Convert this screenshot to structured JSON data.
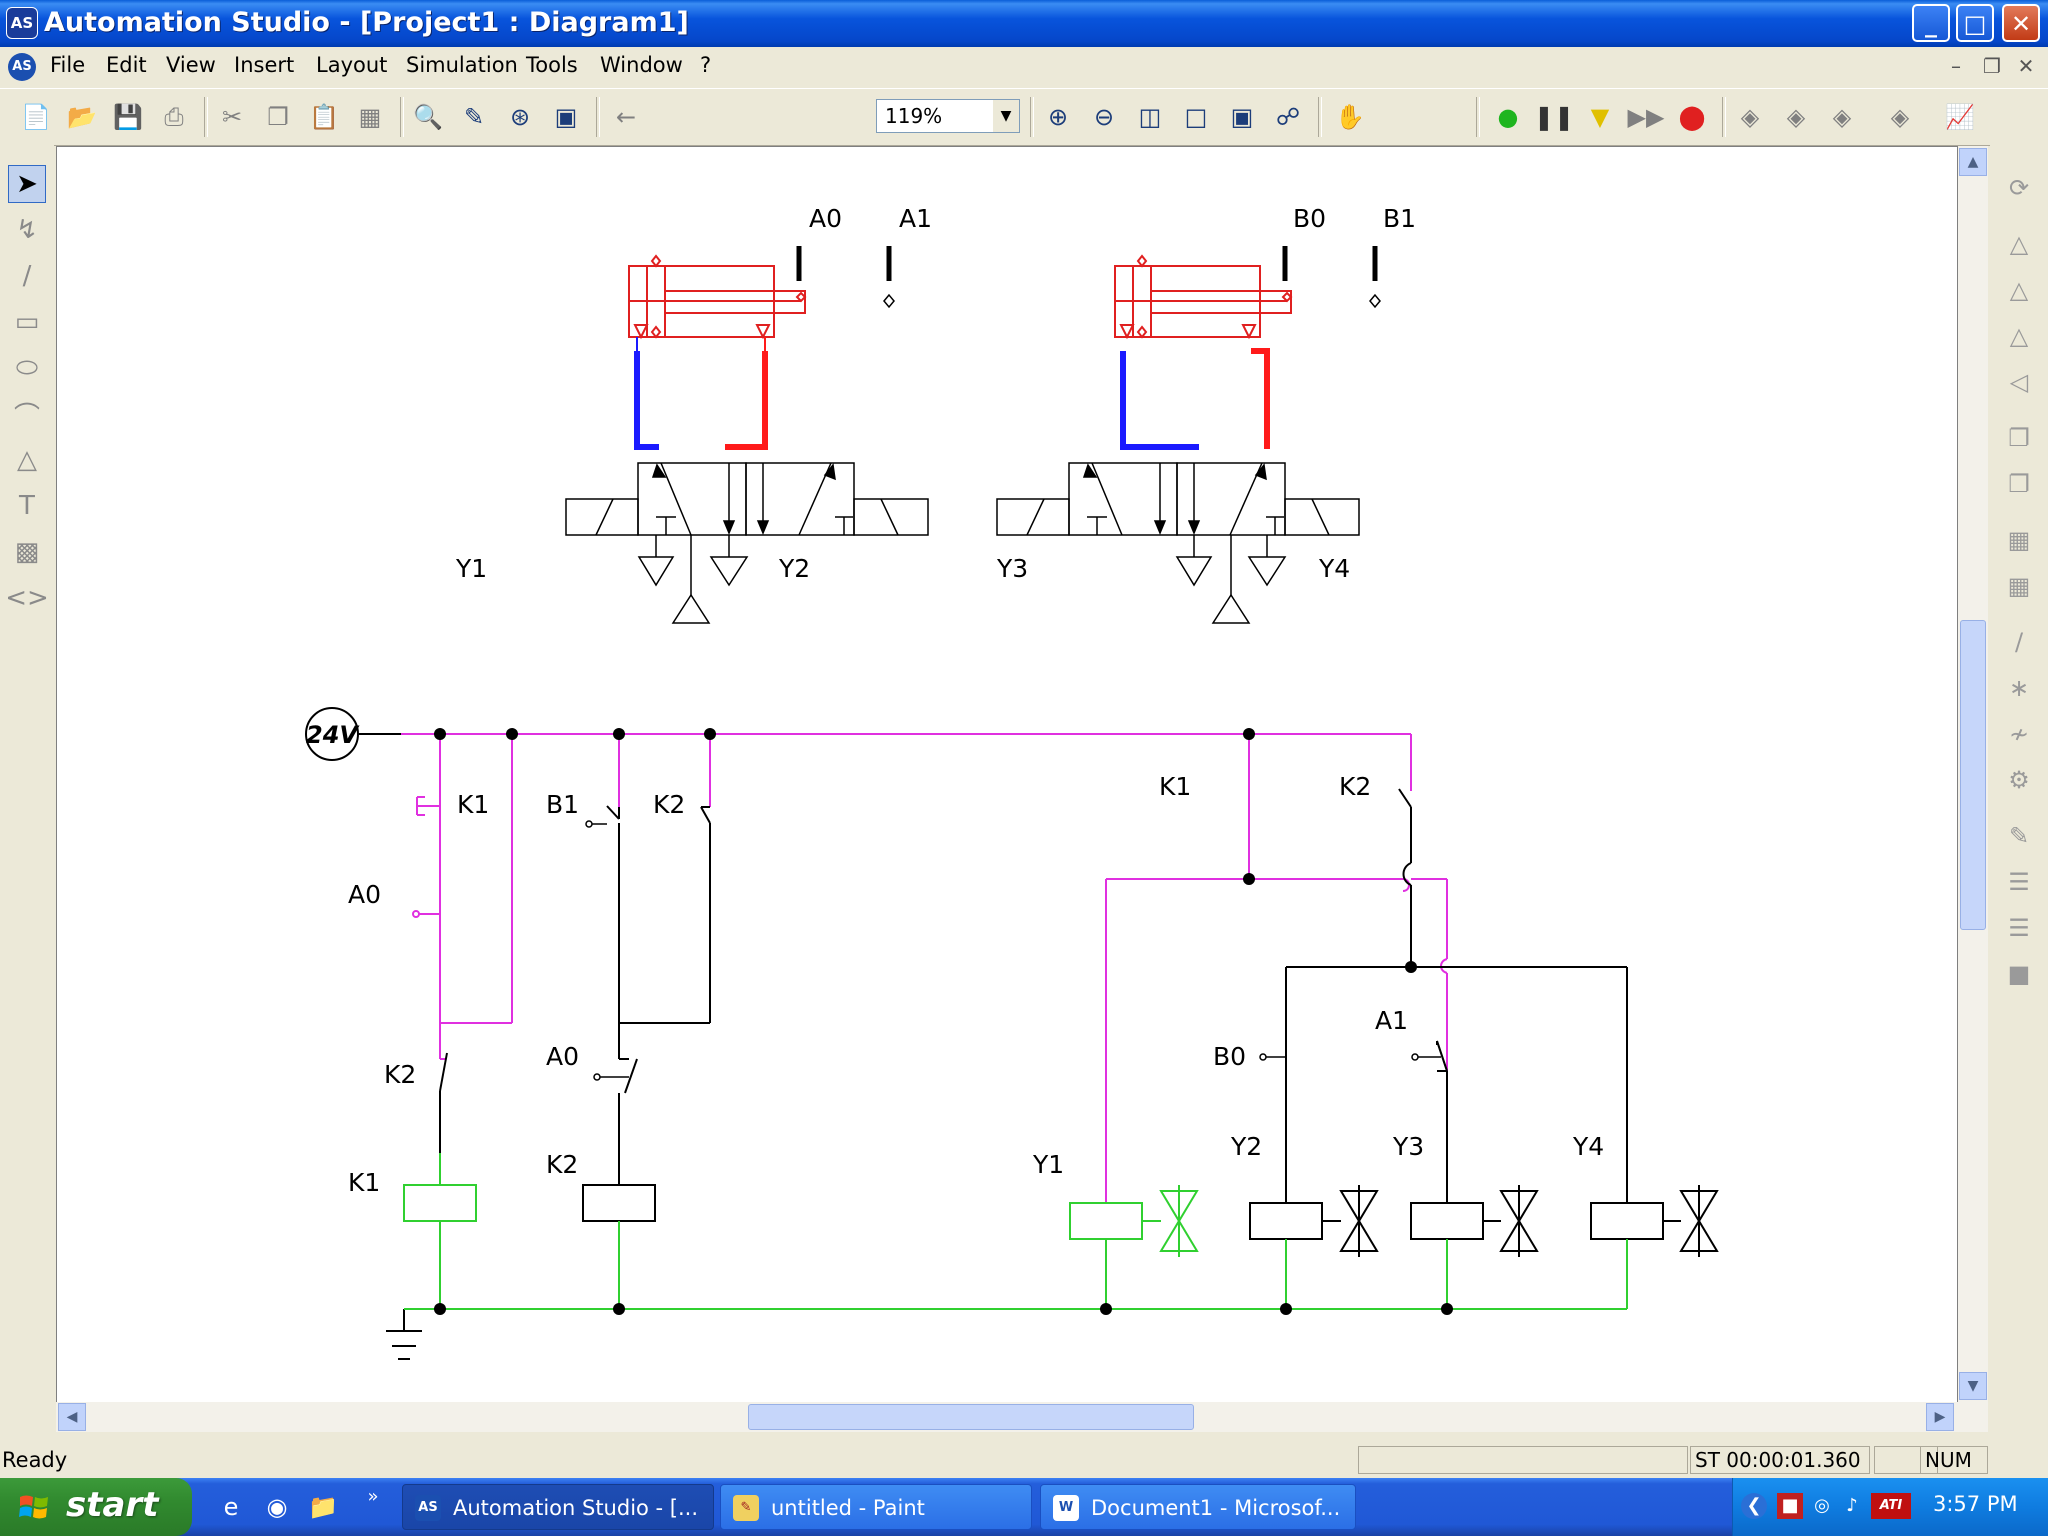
{
  "window": {
    "title": "Automation Studio - [Project1 : Diagram1]",
    "app_icon": "AS"
  },
  "menu": [
    "File",
    "Edit",
    "View",
    "Insert",
    "Layout",
    "Simulation",
    "Tools",
    "Window",
    "?"
  ],
  "toolbar": {
    "zoom": "119%"
  },
  "diagram": {
    "pneumatic": {
      "cylinder_a": {
        "sensor_labels": [
          "A0",
          "A1"
        ]
      },
      "cylinder_b": {
        "sensor_labels": [
          "B0",
          "B1"
        ]
      },
      "valve_1": {
        "solenoid_labels": [
          "Y1",
          "Y2"
        ]
      },
      "valve_2": {
        "solenoid_labels": [
          "Y3",
          "Y4"
        ]
      }
    },
    "electrical": {
      "supply": "24V",
      "labels": {
        "contact_k1_left": "K1",
        "sensor_a0_left": "A0",
        "contact_b1": "B1",
        "contact_k2_top": "K2",
        "contact_k2_left": "K2",
        "contact_a0_mid": "A0",
        "coil_k1": "K1",
        "coil_k2": "K2",
        "contact_k1_right": "K1",
        "contact_k2_right": "K2",
        "sensor_b0": "B0",
        "sensor_a1": "A1",
        "solenoid_y1": "Y1",
        "solenoid_y2": "Y2",
        "solenoid_y3": "Y3",
        "solenoid_y4": "Y4"
      }
    },
    "colors": {
      "active_pink": "#e030e0",
      "active_green": "#30d030",
      "pressure_red": "#ff1a1a",
      "exhaust_blue": "#1a1aff",
      "cylinder_red": "#e02020"
    }
  },
  "status": {
    "left": "Ready",
    "sim_time": "ST 00:00:01.360",
    "num": "NUM"
  },
  "taskbar": {
    "start": "start",
    "tasks": [
      "Automation Studio - [...",
      "untitled - Paint",
      "Document1 - Microsof..."
    ],
    "clock": "3:57 PM"
  }
}
